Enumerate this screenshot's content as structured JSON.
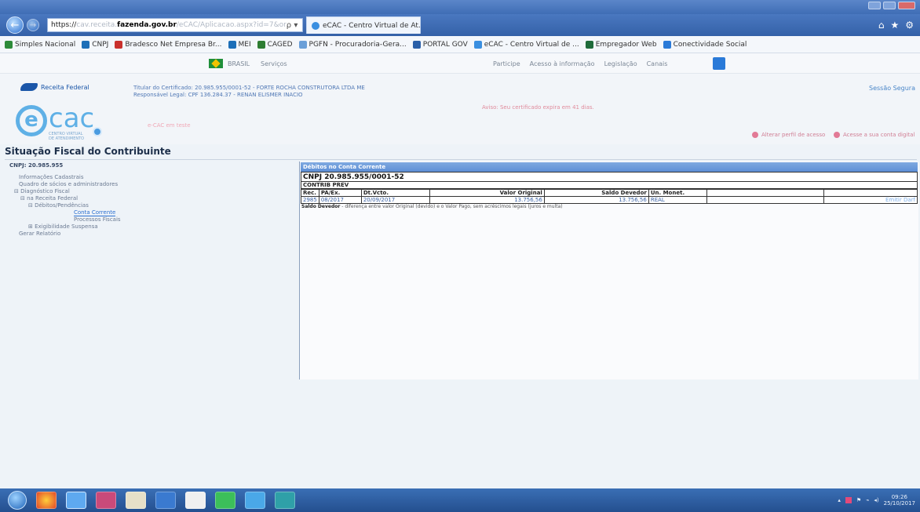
{
  "browser": {
    "address": {
      "scheme": "https://",
      "pre": "cav.receita.",
      "domain": "fazenda.gov.br",
      "path": "/eCAC/Aplicacao.aspx?id=7&or",
      "controls": "ρ ▾ 🔒 C"
    },
    "tab_title": "eCAC - Centro Virtual de At...",
    "favorites": [
      {
        "label": "Simples Nacional",
        "color": "#2e8b3a"
      },
      {
        "label": "CNPJ",
        "color": "#1d6fb8"
      },
      {
        "label": "Bradesco Net Empresa Br...",
        "color": "#c9302c"
      },
      {
        "label": "MEI",
        "color": "#1d6fb8"
      },
      {
        "label": "CAGED",
        "color": "#2e7d32"
      },
      {
        "label": "PGFN - Procuradoria-Gera...",
        "color": "#6a9fd8"
      },
      {
        "label": "PORTAL GOV",
        "color": "#2a5fa8"
      },
      {
        "label": "eCAC - Centro Virtual de ...",
        "color": "#3a8fe0"
      },
      {
        "label": "Empregador Web",
        "color": "#1f6b3a"
      },
      {
        "label": "Conectividade Social",
        "color": "#2a7ad8"
      }
    ]
  },
  "govbar": {
    "brasil": "BRASIL",
    "servicos": "Serviços",
    "links": [
      "Participe",
      "Acesso à informação",
      "Legislação",
      "Canais"
    ]
  },
  "header": {
    "rf_label": "Receita Federal",
    "cert_line1": "Titular do Certificado: 20.985.955/0001-52 - FORTE ROCHA CONSTRUTORA LTDA ME",
    "cert_line2": "Responsável Legal: CPF 136.284.37 - RENAN ELISMER INACIO",
    "sessao": "Sessão Segura",
    "aviso": "Aviso: Seu certificado expira em 41 dias.",
    "pink_left": "e-CAC em teste",
    "btn_perfil": "Alterar perfil de acesso",
    "btn_conta": "Acesse a sua conta digital",
    "logo_sub_1": "CENTRO VIRTUAL",
    "logo_sub_2": "DE ATENDIMENTO"
  },
  "page": {
    "title": "Situação Fiscal do Contribuinte"
  },
  "tree": {
    "cnpj": "CNPJ: 20.985.955",
    "items": [
      "Informações Cadastrais",
      "Quadro de sócios e administradores",
      "⊟ Diagnóstico Fiscal",
      "⊟ na Receita Federal",
      "⊟ Débitos/Pendências",
      "Conta Corrente",
      "Processos Fiscais",
      "⊞ Exigibilidade Suspensa",
      "Gerar Relatório"
    ]
  },
  "debitos": {
    "header": "Débitos no Conta Corrente",
    "cnpj": "CNPJ 20.985.955/0001-52",
    "group": "CONTRIB PREV",
    "columns": [
      "Rec.",
      "PA/Ex.",
      "Dt.Vcto.",
      "Valor Original",
      "Saldo Devedor",
      "Un. Monet."
    ],
    "rows": [
      {
        "rec": "2985",
        "pa": "08/2017",
        "vcto": "20/09/2017",
        "valor": "13.756,56",
        "saldo": "13.756,56",
        "unid": "REAL",
        "acao": "Emitir Darf"
      }
    ],
    "note_label": "Saldo Devedor",
    "note_text": " - diferença entre valor Original (devido) e o Valor Pago, sem acréscimos legais (juros e multa)"
  },
  "taskbar": {
    "time": "09:26",
    "date": "25/10/2017"
  }
}
